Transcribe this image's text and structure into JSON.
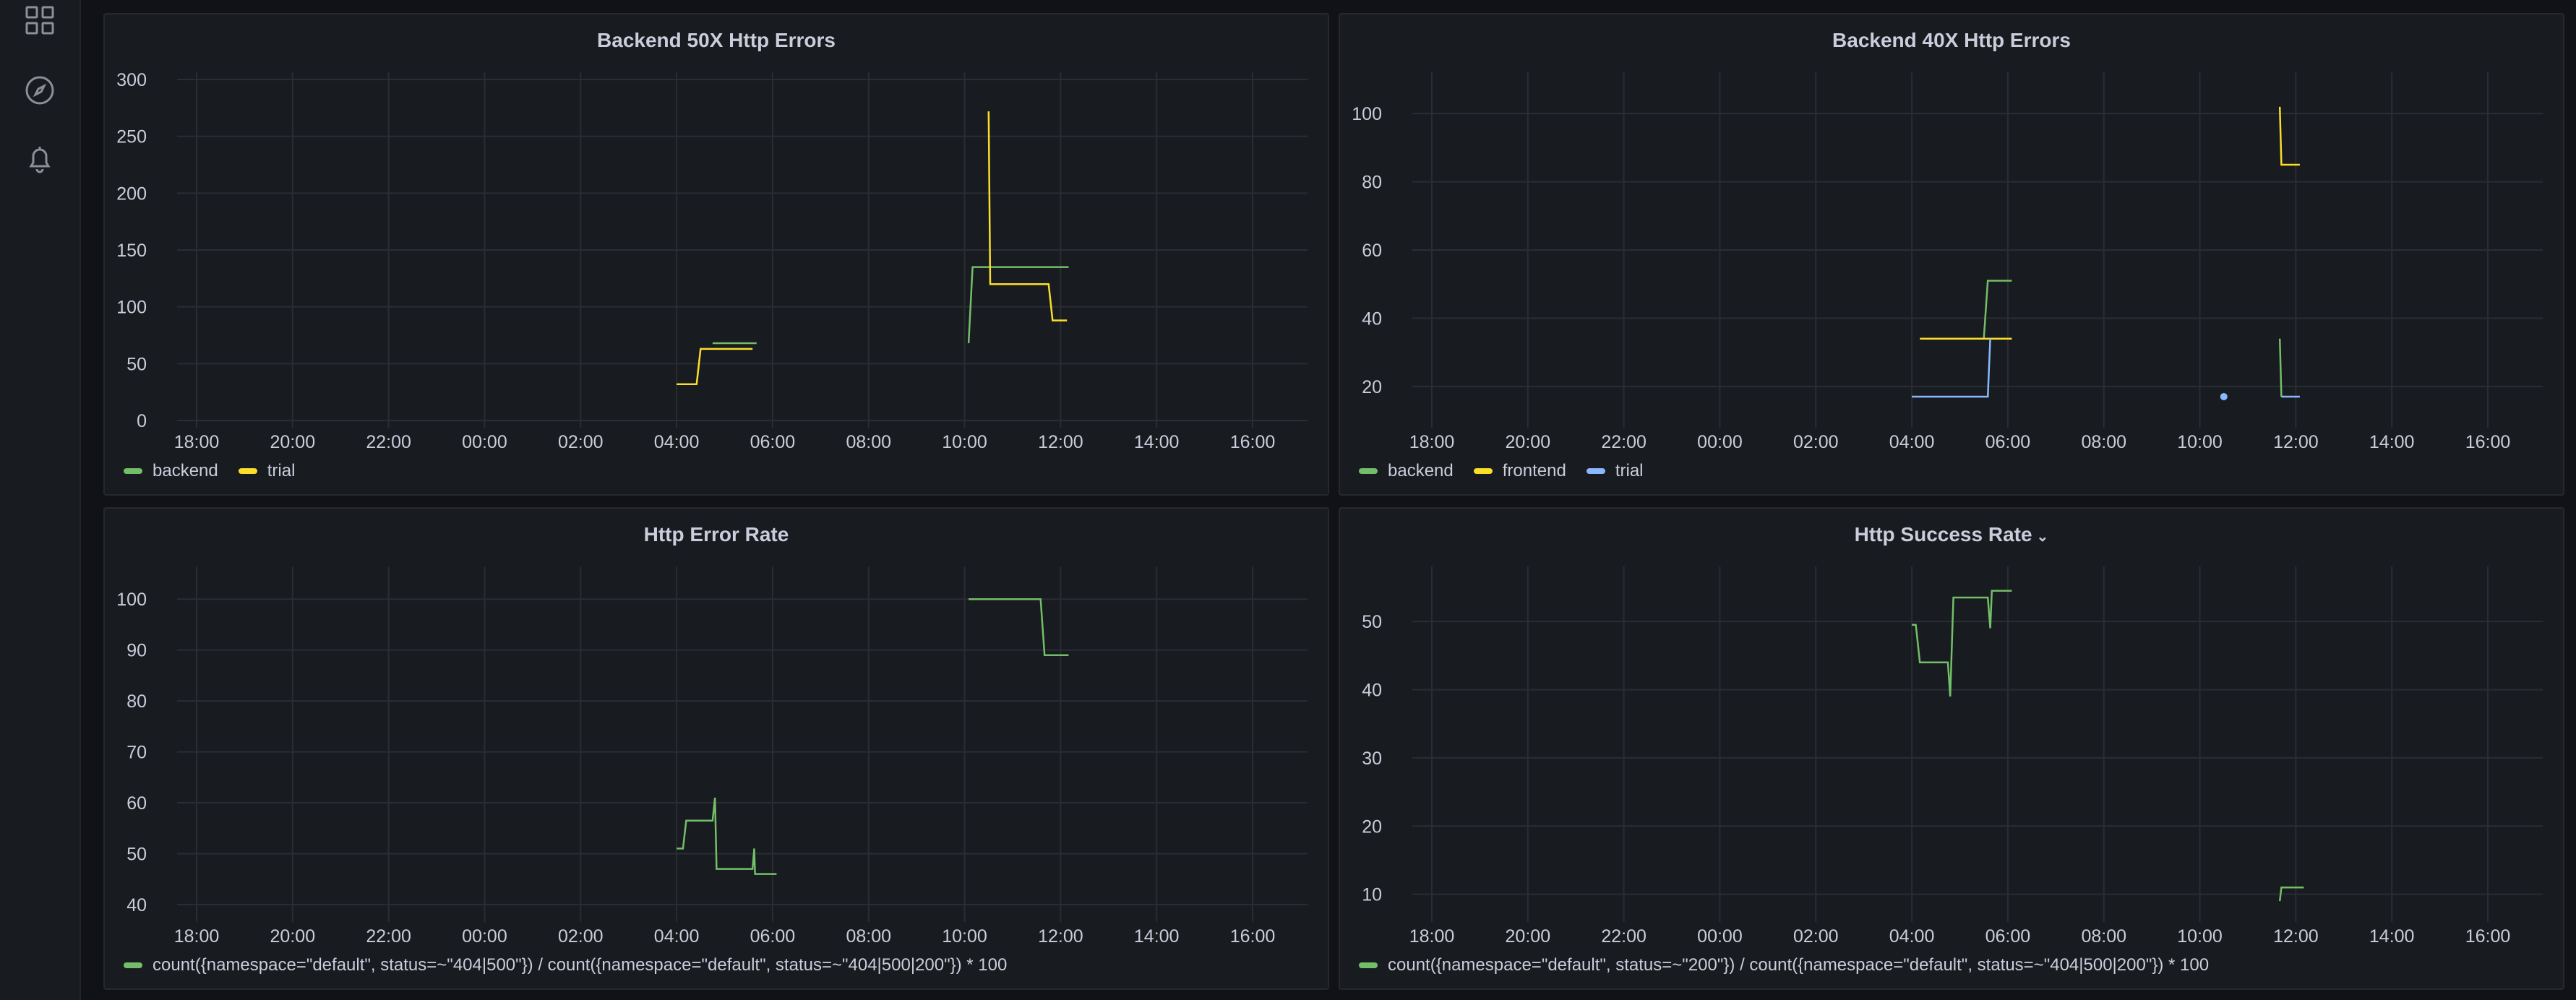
{
  "sidebar": {
    "items": [
      {
        "icon": "dashboards-grid-icon"
      },
      {
        "icon": "explore-compass-icon"
      },
      {
        "icon": "alerting-bell-icon"
      }
    ]
  },
  "colors": {
    "green": "#73bf69",
    "yellow": "#fade2a",
    "blue": "#8ab8ff",
    "grid": "#2a2d34",
    "panel_bg": "#181b1f",
    "page_bg": "#111217"
  },
  "x_ticks": [
    "18:00",
    "20:00",
    "22:00",
    "00:00",
    "02:00",
    "04:00",
    "06:00",
    "08:00",
    "10:00",
    "12:00",
    "14:00",
    "16:00"
  ],
  "panels": [
    {
      "title": "Backend 50X Http Errors",
      "has_menu": false,
      "legend": [
        {
          "name": "backend",
          "color": "#73bf69"
        },
        {
          "name": "trial",
          "color": "#fade2a"
        }
      ],
      "chart_data": {
        "type": "line",
        "title": "Backend 50X Http Errors",
        "xlabel": "",
        "ylabel": "",
        "x_ticks": [
          "18:00",
          "20:00",
          "22:00",
          "00:00",
          "02:00",
          "04:00",
          "06:00",
          "08:00",
          "10:00",
          "12:00",
          "14:00",
          "16:00"
        ],
        "xlim": [
          "17:00",
          "17:25"
        ],
        "ylim": [
          0,
          300
        ],
        "y_ticks": [
          0,
          50,
          100,
          150,
          200,
          250,
          300
        ],
        "series": [
          {
            "name": "backend",
            "color": "#73bf69",
            "segments": [
              [
                [
                  "04:45",
                  68
                ],
                [
                  "05:40",
                  68
                ]
              ],
              [
                [
                  "10:05",
                  68
                ],
                [
                  "10:10",
                  135
                ],
                [
                  "12:10",
                  135
                ]
              ]
            ]
          },
          {
            "name": "trial",
            "color": "#fade2a",
            "segments": [
              [
                [
                  "04:00",
                  32
                ],
                [
                  "04:25",
                  32
                ],
                [
                  "04:30",
                  63
                ],
                [
                  "05:35",
                  63
                ]
              ],
              [
                [
                  "10:30",
                  272
                ],
                [
                  "10:32",
                  120
                ],
                [
                  "11:45",
                  120
                ],
                [
                  "11:50",
                  88
                ],
                [
                  "12:08",
                  88
                ]
              ]
            ]
          }
        ]
      }
    },
    {
      "title": "Backend 40X Http Errors",
      "has_menu": false,
      "legend": [
        {
          "name": "backend",
          "color": "#73bf69"
        },
        {
          "name": "frontend",
          "color": "#fade2a"
        },
        {
          "name": "trial",
          "color": "#8ab8ff"
        }
      ],
      "chart_data": {
        "type": "line",
        "title": "Backend 40X Http Errors",
        "xlabel": "",
        "ylabel": "",
        "x_ticks": [
          "18:00",
          "20:00",
          "22:00",
          "00:00",
          "02:00",
          "04:00",
          "06:00",
          "08:00",
          "10:00",
          "12:00",
          "14:00",
          "16:00"
        ],
        "ylim": [
          10,
          110
        ],
        "y_ticks": [
          20,
          40,
          60,
          80,
          100
        ],
        "series": [
          {
            "name": "backend",
            "color": "#73bf69",
            "segments": [
              [
                [
                  "05:30",
                  34
                ],
                [
                  "05:35",
                  51
                ],
                [
                  "06:05",
                  51
                ]
              ],
              [
                [
                  "11:40",
                  34
                ],
                [
                  "11:42",
                  17
                ]
              ]
            ]
          },
          {
            "name": "frontend",
            "color": "#fade2a",
            "segments": [
              [
                [
                  "04:10",
                  34
                ],
                [
                  "06:05",
                  34
                ]
              ],
              [
                [
                  "11:40",
                  102
                ],
                [
                  "11:42",
                  85
                ],
                [
                  "12:05",
                  85
                ]
              ]
            ]
          },
          {
            "name": "trial",
            "color": "#8ab8ff",
            "segments": [
              [
                [
                  "04:00",
                  17
                ],
                [
                  "05:35",
                  17
                ],
                [
                  "05:38",
                  34
                ]
              ],
              [
                [
                  "11:42",
                  17
                ],
                [
                  "12:05",
                  17
                ]
              ]
            ],
            "points": [
              [
                "10:30",
                17
              ]
            ]
          }
        ]
      }
    },
    {
      "title": "Http Error Rate",
      "has_menu": false,
      "legend": [
        {
          "name": "count({namespace=\"default\", status=~\"404|500\"}) / count({namespace=\"default\", status=~\"404|500|200\"}) * 100",
          "color": "#73bf69"
        }
      ],
      "chart_data": {
        "type": "line",
        "title": "Http Error Rate",
        "xlabel": "",
        "ylabel": "",
        "x_ticks": [
          "18:00",
          "20:00",
          "22:00",
          "00:00",
          "02:00",
          "04:00",
          "06:00",
          "08:00",
          "10:00",
          "12:00",
          "14:00",
          "16:00"
        ],
        "ylim": [
          38,
          105
        ],
        "y_ticks": [
          40,
          50,
          60,
          70,
          80,
          90,
          100
        ],
        "series": [
          {
            "name": "count({namespace=\"default\", status=~\"404|500\"}) / count({namespace=\"default\", status=~\"404|500|200\"}) * 100",
            "color": "#73bf69",
            "segments": [
              [
                [
                  "04:00",
                  51
                ],
                [
                  "04:08",
                  51
                ],
                [
                  "04:12",
                  56.5
                ],
                [
                  "04:45",
                  56.5
                ],
                [
                  "04:48",
                  61
                ],
                [
                  "04:50",
                  47
                ],
                [
                  "05:35",
                  47
                ],
                [
                  "05:37",
                  51
                ],
                [
                  "05:38",
                  46
                ],
                [
                  "06:05",
                  46
                ]
              ],
              [
                [
                  "10:05",
                  100
                ],
                [
                  "11:35",
                  100
                ],
                [
                  "11:40",
                  89
                ],
                [
                  "12:10",
                  89
                ]
              ]
            ]
          }
        ]
      }
    },
    {
      "title": "Http Success Rate",
      "has_menu": true,
      "legend": [
        {
          "name": "count({namespace=\"default\", status=~\"200\"}) / count({namespace=\"default\", status=~\"404|500|200\"}) * 100",
          "color": "#73bf69"
        }
      ],
      "chart_data": {
        "type": "line",
        "title": "Http Success Rate",
        "xlabel": "",
        "ylabel": "",
        "x_ticks": [
          "18:00",
          "20:00",
          "22:00",
          "00:00",
          "02:00",
          "04:00",
          "06:00",
          "08:00",
          "10:00",
          "12:00",
          "14:00",
          "16:00"
        ],
        "ylim": [
          7,
          57
        ],
        "y_ticks": [
          10,
          20,
          30,
          40,
          50
        ],
        "series": [
          {
            "name": "count({namespace=\"default\", status=~\"200\"}) / count({namespace=\"default\", status=~\"404|500|200\"}) * 100",
            "color": "#73bf69",
            "segments": [
              [
                [
                  "04:00",
                  49.5
                ],
                [
                  "04:05",
                  49.5
                ],
                [
                  "04:10",
                  44
                ],
                [
                  "04:45",
                  44
                ],
                [
                  "04:48",
                  39
                ],
                [
                  "04:52",
                  53.5
                ],
                [
                  "05:35",
                  53.5
                ],
                [
                  "05:38",
                  49
                ],
                [
                  "05:40",
                  54.5
                ],
                [
                  "06:05",
                  54.5
                ]
              ],
              [
                [
                  "11:40",
                  9
                ],
                [
                  "11:42",
                  11
                ],
                [
                  "12:10",
                  11
                ]
              ]
            ]
          }
        ]
      }
    }
  ]
}
